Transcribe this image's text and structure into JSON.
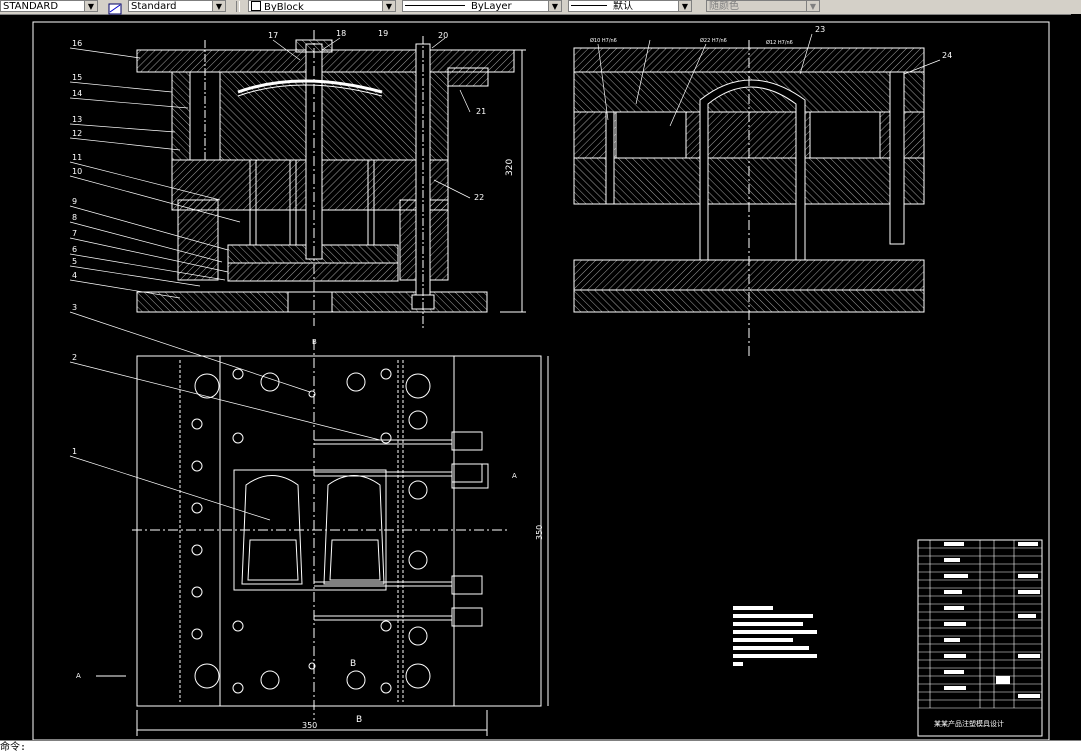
{
  "toolbar": {
    "text_style": "STANDARD",
    "dim_style": "Standard",
    "layer_color": "ByBlock",
    "linetype": "ByLayer",
    "lineweight": "默认",
    "plot_style": "随颜色"
  },
  "drawing": {
    "part_labels": [
      "1",
      "2",
      "3",
      "4",
      "5",
      "6",
      "7",
      "8",
      "9",
      "10",
      "11",
      "12",
      "13",
      "14",
      "15",
      "16",
      "17",
      "18",
      "19",
      "20",
      "21",
      "22",
      "23",
      "24"
    ],
    "dimensions": {
      "section_height": "320",
      "plan_height": "350",
      "plan_width": "350"
    },
    "section_marks": {
      "a_left": "A",
      "a_right": "A",
      "b_top": "B",
      "b_bottom": "B",
      "b_mid": "B"
    },
    "fit_notes": [
      "Ø10 H7/n6",
      "Ø22 H7/n6",
      "Ø12 H7/n6"
    ],
    "title_block_caption": "某某产品注塑模具设计"
  },
  "command_line": {
    "prompt": "命令:"
  }
}
